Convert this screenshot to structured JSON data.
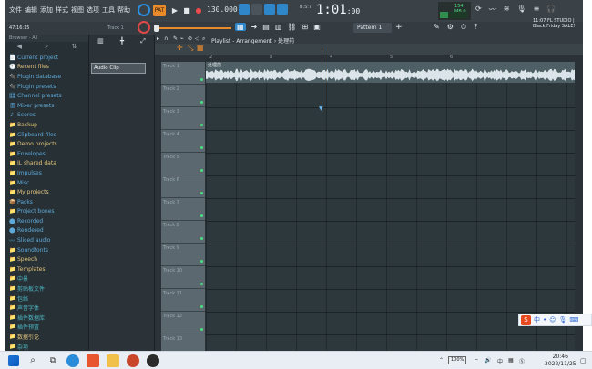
{
  "menu": [
    "文件",
    "编辑",
    "添加",
    "样式",
    "视图",
    "选项",
    "工具",
    "帮助"
  ],
  "transport": {
    "pattern_btn": "PAT",
    "bpm": "130.000"
  },
  "clock": {
    "main": "1:01",
    "sub": ":00",
    "tag": "B:S:T"
  },
  "cpu": {
    "text": "154 MB\n0"
  },
  "hint": "47:16:15",
  "track_label": "Track 1",
  "pattern": {
    "label": "Pattern 1"
  },
  "news": "11:07  FL STUDIO | Black Friday SALE!",
  "browser": {
    "header": "Browser - All",
    "items": [
      {
        "icon": "📄",
        "label": "Current project",
        "color": "blue"
      },
      {
        "icon": "🕘",
        "label": "Recent files",
        "color": "yellow"
      },
      {
        "icon": "🔌",
        "label": "Plugin database",
        "color": "blue"
      },
      {
        "icon": "🔌",
        "label": "Plugin presets",
        "color": "blue"
      },
      {
        "icon": "🎛",
        "label": "Channel presets",
        "color": "blue"
      },
      {
        "icon": "🎚",
        "label": "Mixer presets",
        "color": "blue"
      },
      {
        "icon": "♪",
        "label": "Scores",
        "color": "blue"
      },
      {
        "icon": "📁",
        "label": "Backup",
        "color": "yellow"
      },
      {
        "icon": "📁",
        "label": "Clipboard files",
        "color": "blue"
      },
      {
        "icon": "📁",
        "label": "Demo projects",
        "color": "yellow"
      },
      {
        "icon": "📁",
        "label": "Envelopes",
        "color": "blue"
      },
      {
        "icon": "📁",
        "label": "IL shared data",
        "color": "yellow"
      },
      {
        "icon": "📁",
        "label": "Impulses",
        "color": "blue"
      },
      {
        "icon": "📁",
        "label": "Misc",
        "color": "blue"
      },
      {
        "icon": "📁",
        "label": "My projects",
        "color": "yellow"
      },
      {
        "icon": "📦",
        "label": "Packs",
        "color": "blue"
      },
      {
        "icon": "📁",
        "label": "Project bones",
        "color": "blue"
      },
      {
        "icon": "⬤",
        "label": "Recorded",
        "color": "blue"
      },
      {
        "icon": "⬤",
        "label": "Rendered",
        "color": "blue"
      },
      {
        "icon": "〰",
        "label": "Sliced audio",
        "color": "blue"
      },
      {
        "icon": "📁",
        "label": "Soundfonts",
        "color": "blue"
      },
      {
        "icon": "📁",
        "label": "Speech",
        "color": "yellow"
      },
      {
        "icon": "📁",
        "label": "Templates",
        "color": "yellow"
      },
      {
        "icon": "📁",
        "label": "中景",
        "color": "teal"
      },
      {
        "icon": "📁",
        "label": "剪贴板文件",
        "color": "teal"
      },
      {
        "icon": "📁",
        "label": "包络",
        "color": "teal"
      },
      {
        "icon": "📁",
        "label": "声音字体",
        "color": "teal"
      },
      {
        "icon": "📁",
        "label": "插件数据库",
        "color": "teal"
      },
      {
        "icon": "📁",
        "label": "插件预置",
        "color": "teal"
      },
      {
        "icon": "📁",
        "label": "数据引论",
        "color": "yellow"
      },
      {
        "icon": "📁",
        "label": "杂项",
        "color": "teal"
      }
    ]
  },
  "picker": {
    "audio_clip": "Audio Clip"
  },
  "playlist": {
    "title": "Playlist - Arrangement",
    "clip_name": "处理前",
    "sub": "处理前",
    "ruler": [
      "2",
      "3",
      "4",
      "5",
      "6"
    ],
    "tracks": [
      "Track 1",
      "Track 2",
      "Track 3",
      "Track 4",
      "Track 5",
      "Track 6",
      "Track 7",
      "Track 8",
      "Track 9",
      "Track 10",
      "Track 11",
      "Track 12",
      "Track 13"
    ]
  },
  "ime": {
    "s": "S",
    "label": "中"
  },
  "taskbar": {
    "battery": "100%",
    "time": "20:46",
    "date": "2022/11/25",
    "ime_tray": "中"
  },
  "colors": {
    "accent_orange": "#e98b2b",
    "accent_blue": "#2f86c9",
    "led_green": "#4be07f",
    "bg_dark": "#2c3338"
  }
}
